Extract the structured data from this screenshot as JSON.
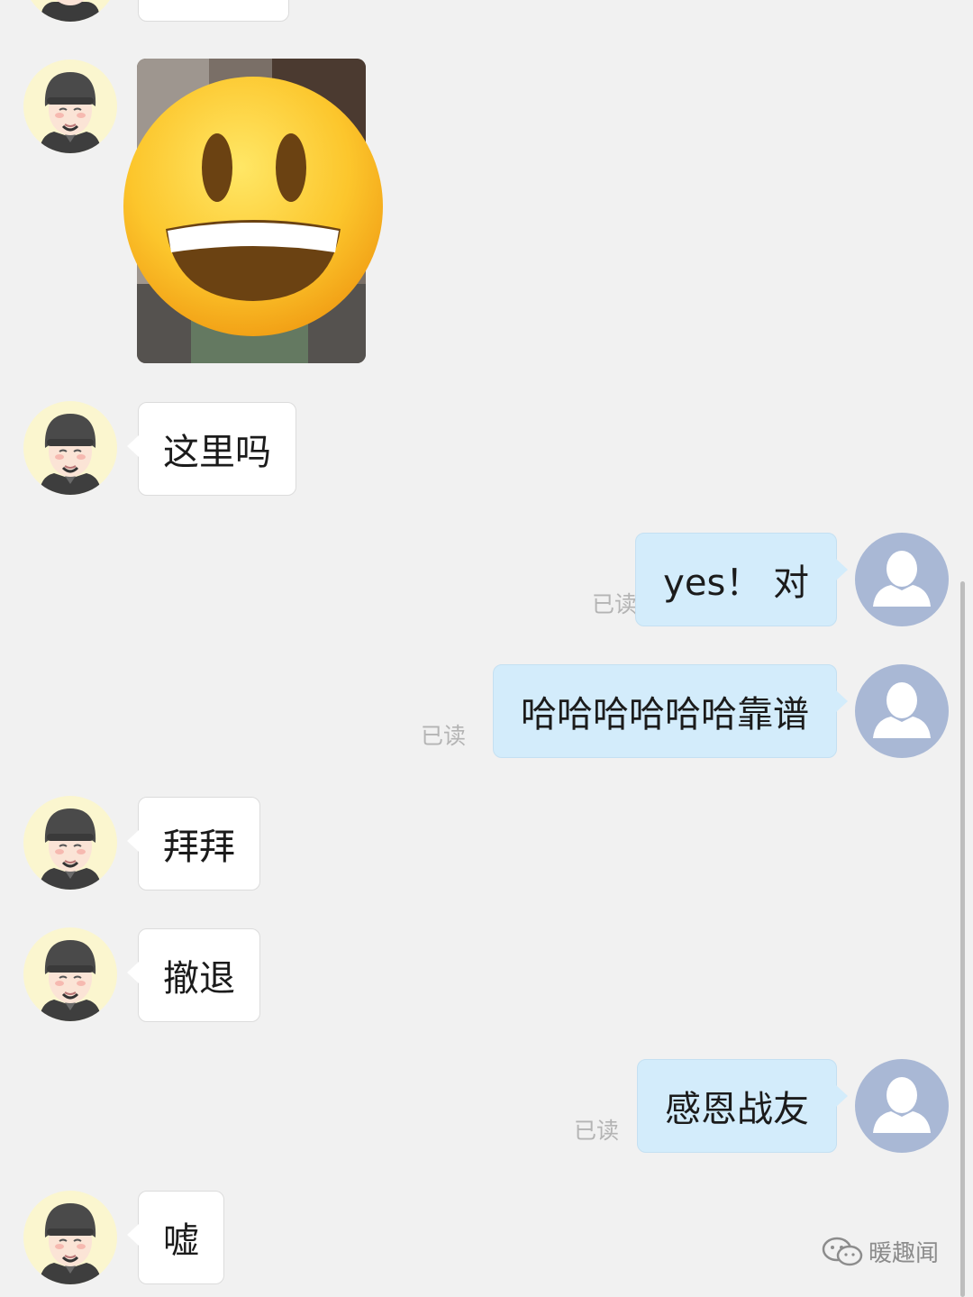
{
  "messages": [
    {
      "side": "left",
      "type": "text",
      "text": ""
    },
    {
      "side": "left",
      "type": "image",
      "icon": "grinning-face-emoji-icon"
    },
    {
      "side": "left",
      "type": "text",
      "text": "这里吗"
    },
    {
      "side": "right",
      "type": "text",
      "text": "yes！ 对",
      "status": "已读"
    },
    {
      "side": "right",
      "type": "text",
      "text": "哈哈哈哈哈哈靠谱",
      "status": "已读"
    },
    {
      "side": "left",
      "type": "text",
      "text": "拜拜"
    },
    {
      "side": "left",
      "type": "text",
      "text": "撤退"
    },
    {
      "side": "right",
      "type": "text",
      "text": "感恩战友",
      "status": "已读"
    },
    {
      "side": "left",
      "type": "text",
      "text": "嘘"
    }
  ],
  "watermark": {
    "text": "暖趣闻",
    "icon": "wechat-icon"
  },
  "colors": {
    "background": "#f1f1f1",
    "incoming_bubble": "#ffffff",
    "outgoing_bubble": "#d3ecfb",
    "read_status": "#b4b4b4",
    "outgoing_avatar": "#a9b8d5",
    "incoming_avatar": "#fbf6cf"
  }
}
